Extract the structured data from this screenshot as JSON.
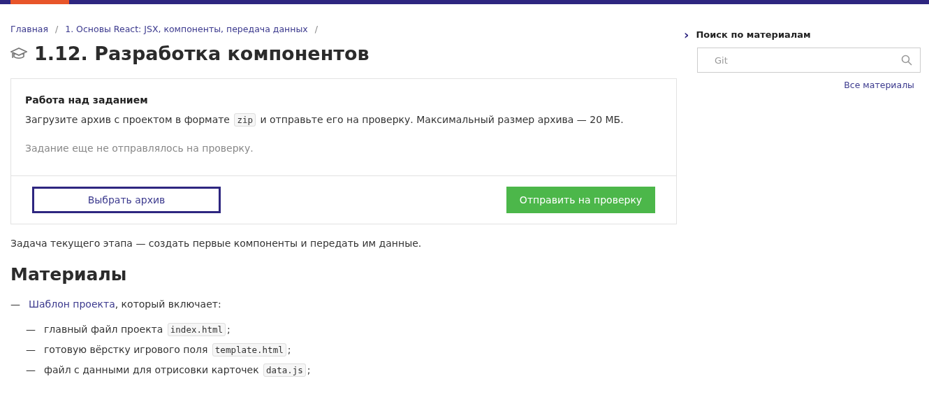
{
  "breadcrumbs": [
    {
      "label": "Главная",
      "separator": "/"
    },
    {
      "label": "1. Основы React: JSX, компоненты, передача данных",
      "separator": "/"
    }
  ],
  "title": "1.12. Разработка компонентов",
  "task": {
    "heading": "Работа над заданием",
    "description": {
      "before": "Загрузите архив с проектом в формате",
      "code": "zip",
      "after": "и отправьте его на проверку. Максимальный размер архива — 20 МБ."
    },
    "status": "Задание еще не отправлялось на проверку.",
    "choose_button": "Выбрать архив",
    "submit_button": "Отправить на проверку"
  },
  "intro": "Задача текущего этапа — создать первые компоненты и передать им данные.",
  "materials": {
    "heading": "Материалы",
    "items": [
      {
        "bullet": "—",
        "link": "Шаблон проекта",
        "text": ", который включает:",
        "children": [
          {
            "bullet": "—",
            "text": "главный файл проекта",
            "code": "index.html",
            "suffix": ";"
          },
          {
            "bullet": "—",
            "text": "готовую вёрстку игрового поля",
            "code": "template.html",
            "suffix": ";"
          },
          {
            "bullet": "—",
            "text": "файл с данными для отрисовки карточек",
            "code": "data.js",
            "suffix": ";"
          }
        ]
      }
    ]
  },
  "sidebar": {
    "toggle": "›",
    "heading": "Поиск по материалам",
    "search": {
      "placeholder": "Git"
    },
    "all_link": "Все материалы"
  }
}
